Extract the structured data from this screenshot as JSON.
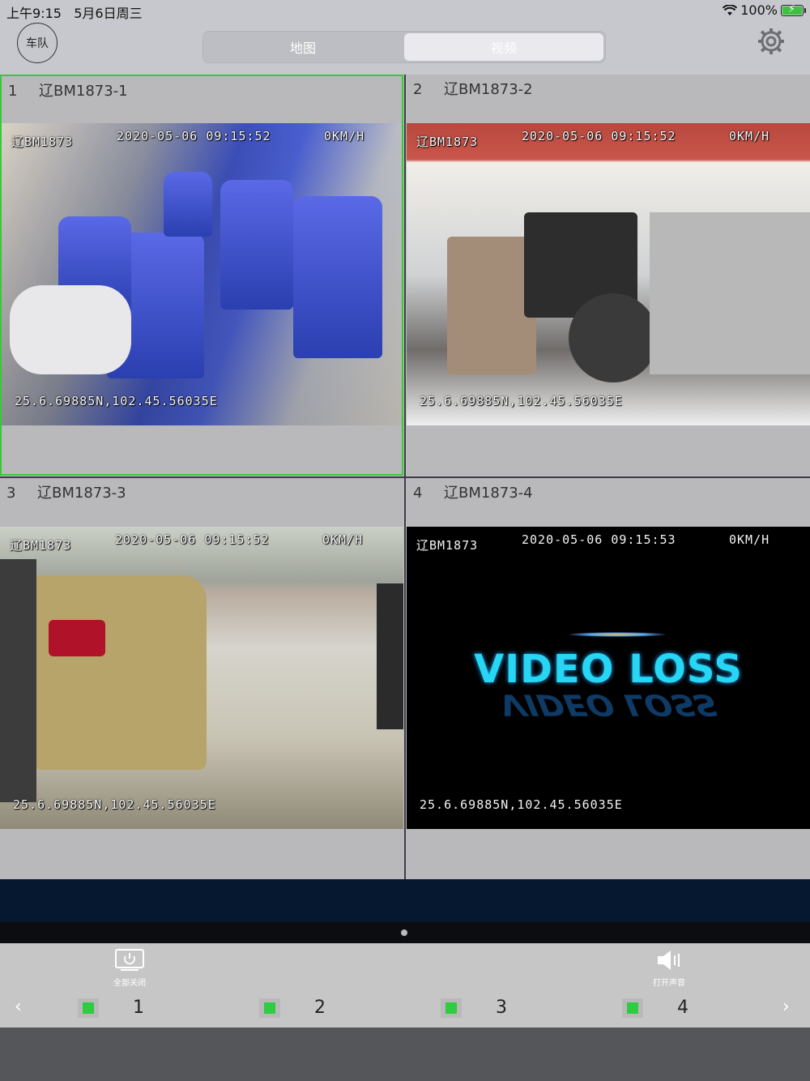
{
  "status_bar": {
    "time": "上午9:15",
    "date": "5月6日周三",
    "battery": "100%",
    "wifi_icon": "wifi-icon"
  },
  "nav": {
    "fleet_button": "车队",
    "tabs": [
      {
        "label": "地图",
        "active": false
      },
      {
        "label": "视频",
        "active": true
      }
    ],
    "settings_icon": "gear-icon"
  },
  "video_grid": {
    "cells": [
      {
        "index": "1",
        "title": "辽BM1873-1",
        "selected": true,
        "osd": {
          "plate": "辽BM1873",
          "datetime": "2020-05-06  09:15:52",
          "speed": "0KM/H",
          "gps": "25.6.69885N,102.45.56035E"
        }
      },
      {
        "index": "2",
        "title": "辽BM1873-2",
        "selected": false,
        "osd": {
          "plate": "辽BM1873",
          "datetime": "2020-05-06  09:15:52",
          "speed": "0KM/H",
          "gps": "25.6.69885N,102.45.56035E"
        }
      },
      {
        "index": "3",
        "title": "辽BM1873-3",
        "selected": false,
        "osd": {
          "plate": "辽BM1873",
          "datetime": "2020-05-06  09:15:52",
          "speed": "0KM/H",
          "gps": "25.6.69885N,102.45.56035E"
        }
      },
      {
        "index": "4",
        "title": "辽BM1873-4",
        "selected": false,
        "osd": {
          "plate": "辽BM1873",
          "datetime": "2020-05-06  09:15:53",
          "speed": "0KM/H",
          "gps": "25.6.69885N,102.45.56035E"
        },
        "video_loss_text": "VIDEO LOSS"
      }
    ]
  },
  "controls": {
    "close_all_label": "全部关闭",
    "sound_label": "打开声音",
    "channels": [
      "1",
      "2",
      "3",
      "4"
    ],
    "channel_status_color": "#2ecc40",
    "selection_color": "#33cc33"
  }
}
